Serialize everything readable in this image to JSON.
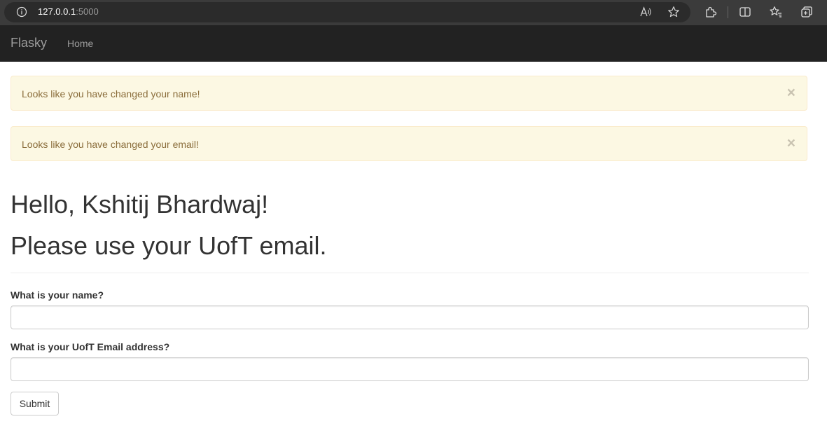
{
  "browser": {
    "url_host": "127.0.0.1",
    "url_port": ":5000",
    "icons": [
      "info-icon",
      "read-aloud-icon",
      "favorite-star-icon",
      "extensions-icon",
      "split-screen-icon",
      "favorites-icon",
      "collections-icon"
    ]
  },
  "navbar": {
    "brand": "Flasky",
    "links": [
      {
        "label": "Home"
      }
    ]
  },
  "alerts": [
    {
      "message": "Looks like you have changed your name!",
      "close": "×"
    },
    {
      "message": "Looks like you have changed your email!",
      "close": "×"
    }
  ],
  "page": {
    "greeting": "Hello, Kshitij Bhardwaj!",
    "note": "Please use your UofT email."
  },
  "form": {
    "name_label": "What is your name?",
    "name_value": "",
    "email_label": "What is your UofT Email address?",
    "email_value": "",
    "submit_label": "Submit"
  },
  "colors": {
    "navbar_bg": "#222222",
    "alert_bg": "#fcf8e3",
    "alert_text": "#8a6d3b"
  }
}
